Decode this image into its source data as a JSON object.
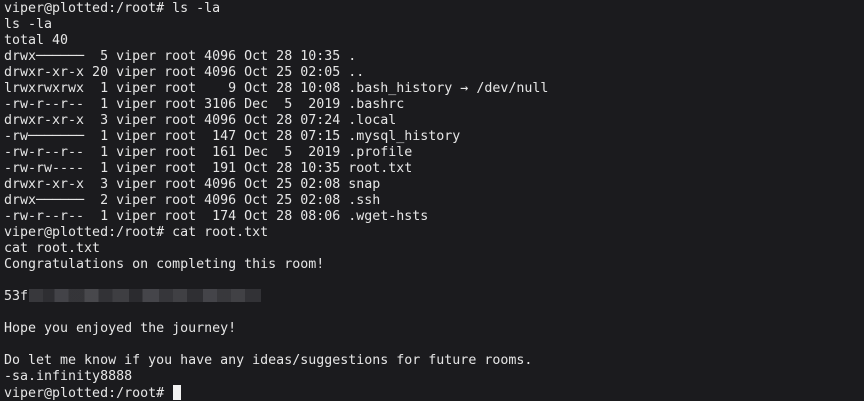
{
  "terminal": {
    "lines": [
      "viper@plotted:/root# ls -la",
      "ls -la",
      "total 40",
      "drwx──────  5 viper root 4096 Oct 28 10:35 .",
      "drwxr-xr-x 20 viper root 4096 Oct 25 02:05 ..",
      "lrwxrwxrwx  1 viper root    9 Oct 28 10:08 .bash_history → /dev/null",
      "-rw-r--r--  1 viper root 3106 Dec  5  2019 .bashrc",
      "drwxr-xr-x  3 viper root 4096 Oct 28 07:24 .local",
      "-rw───────  1 viper root  147 Oct 28 07:15 .mysql_history",
      "-rw-r--r--  1 viper root  161 Dec  5  2019 .profile",
      "-rw-rw----  1 viper root  191 Oct 28 10:35 root.txt",
      "drwxr-xr-x  3 viper root 4096 Oct 25 02:08 snap",
      "drwx──────  2 viper root 4096 Oct 25 02:08 .ssh",
      "-rw-r--r--  1 viper root  174 Oct 28 08:06 .wget-hsts",
      "viper@plotted:/root# cat root.txt",
      "cat root.txt",
      "Congratulations on completing this room!",
      "",
      "53f",
      "",
      "Hope you enjoyed the journey!",
      "",
      "Do let me know if you have any ideas/suggestions for future rooms.",
      "-sa.infinity8888",
      "viper@plotted:/root# "
    ]
  }
}
